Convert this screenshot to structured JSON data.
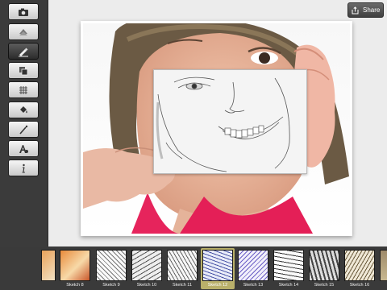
{
  "toolbar": {
    "items": [
      {
        "name": "camera-icon",
        "active": false
      },
      {
        "name": "layers-icon",
        "active": false
      },
      {
        "name": "sketch-effect-icon",
        "active": true
      },
      {
        "name": "duplicate-icon",
        "active": false
      },
      {
        "name": "grid-icon",
        "active": false
      },
      {
        "name": "paint-bucket-icon",
        "active": false
      },
      {
        "name": "magic-wand-icon",
        "active": false
      },
      {
        "name": "text-effects-icon",
        "active": false
      },
      {
        "name": "info-icon",
        "active": false
      }
    ]
  },
  "share": {
    "label": "Share"
  },
  "filmstrip": {
    "thumbs": [
      {
        "label": ""
      },
      {
        "label": "Sketch 8"
      },
      {
        "label": "Sketch 9"
      },
      {
        "label": "Sketch 10"
      },
      {
        "label": "Sketch 11"
      },
      {
        "label": "Sketch 12"
      },
      {
        "label": "Sketch 13"
      },
      {
        "label": "Sketch 14"
      },
      {
        "label": "Sketch 15"
      },
      {
        "label": "Sketch 16"
      },
      {
        "label": ""
      }
    ],
    "selected_label": "Sketch 12"
  },
  "colors": {
    "toolbar_bg": "#3b3b3b",
    "filmstrip_bg": "#3a3a3a",
    "selected_thumb": "#b9b06a"
  }
}
